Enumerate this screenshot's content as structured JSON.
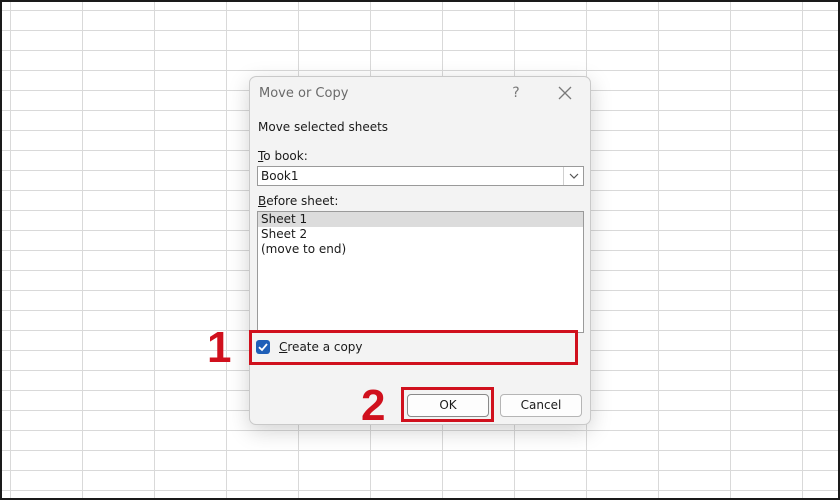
{
  "dialog": {
    "title": "Move or Copy",
    "help_label": "?",
    "section_label": "Move selected sheets",
    "to_book": {
      "label_prefix": "T",
      "label_rest": "o book:",
      "value": "Book1"
    },
    "before_sheet": {
      "label_prefix": "B",
      "label_rest": "efore sheet:",
      "items": [
        {
          "label": "Sheet 1",
          "selected": true
        },
        {
          "label": "Sheet 2",
          "selected": false
        },
        {
          "label": "(move to end)",
          "selected": false
        }
      ]
    },
    "create_copy": {
      "label_prefix": "C",
      "label_rest": "reate a copy",
      "checked": true
    },
    "ok_label": "OK",
    "cancel_label": "Cancel"
  },
  "annotations": {
    "step1": "1",
    "step2": "2",
    "color": "#d0101d"
  },
  "colors": {
    "checkbox_accent": "#1f5fb8",
    "grid_line": "#d9d9d9"
  }
}
